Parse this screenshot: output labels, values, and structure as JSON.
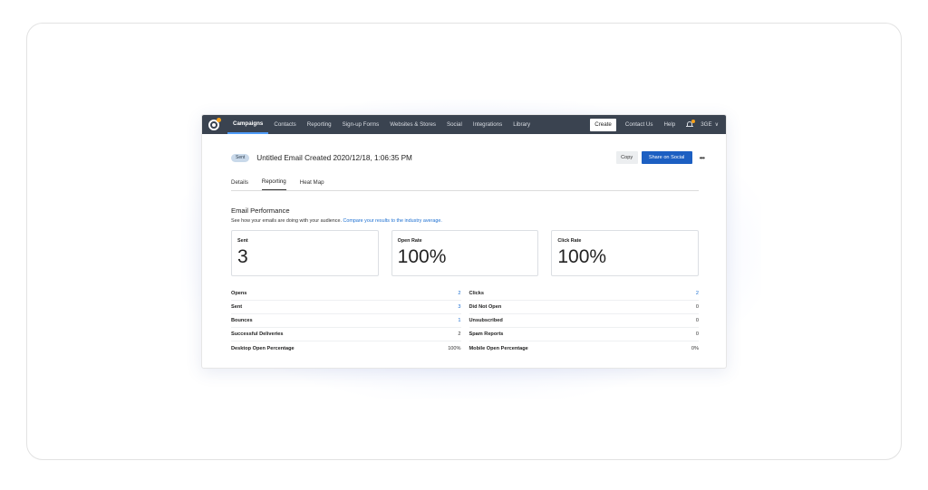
{
  "nav": {
    "items": [
      "Campaigns",
      "Contacts",
      "Reporting",
      "Sign-up Forms",
      "Websites & Stores",
      "Social",
      "Integrations",
      "Library"
    ],
    "create_label": "Create",
    "contact_us": "Contact Us",
    "help": "Help",
    "account": "3GE"
  },
  "header": {
    "status": "Sent",
    "title": "Untitled Email Created 2020/12/18, 1:06:35 PM",
    "copy_label": "Copy",
    "share_label": "Share on Social",
    "more_label": "•••"
  },
  "tabs": [
    "Details",
    "Reporting",
    "Heat Map"
  ],
  "performance": {
    "title": "Email Performance",
    "subtitle": "See how your emails are doing with your audience.",
    "compare_link": "Compare your results to the industry average."
  },
  "cards": [
    {
      "label": "Sent",
      "value": "3"
    },
    {
      "label": "Open Rate",
      "value": "100%"
    },
    {
      "label": "Click Rate",
      "value": "100%"
    }
  ],
  "stats_left": [
    {
      "label": "Opens",
      "value": "2",
      "link": true
    },
    {
      "label": "Sent",
      "value": "3",
      "link": true
    },
    {
      "label": "Bounces",
      "value": "1",
      "link": true
    },
    {
      "label": "Successful Deliveries",
      "value": "2",
      "link": false
    },
    {
      "label": "Desktop Open Percentage",
      "value": "100%",
      "link": false
    }
  ],
  "stats_right": [
    {
      "label": "Clicks",
      "value": "2",
      "link": true
    },
    {
      "label": "Did Not Open",
      "value": "0",
      "link": false
    },
    {
      "label": "Unsubscribed",
      "value": "0",
      "link": false
    },
    {
      "label": "Spam Reports",
      "value": "0",
      "link": false
    },
    {
      "label": "Mobile Open Percentage",
      "value": "0%",
      "link": false
    }
  ],
  "colors": {
    "nav_bg": "#3a4350",
    "accent": "#1c5fc2",
    "link": "#1c6fd1",
    "logo_spark": "#f7a21b"
  }
}
